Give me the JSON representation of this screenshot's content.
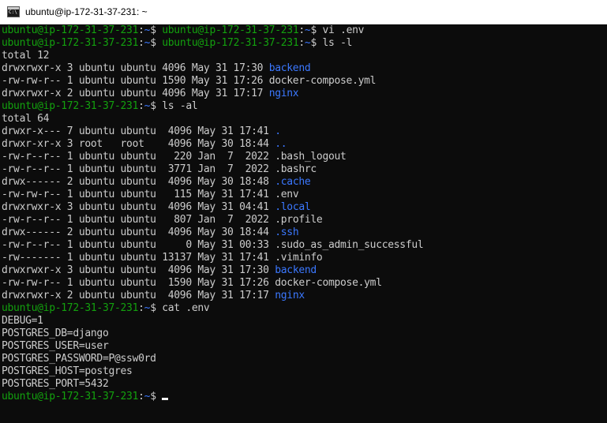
{
  "window": {
    "title": "ubuntu@ip-172-31-37-231: ~",
    "icon": "console-app-icon"
  },
  "colors": {
    "background": "#0c0c0c",
    "foreground": "#cccccc",
    "user_host": "#13a10e",
    "path": "#3b78ff",
    "directory": "#3b78ff"
  },
  "terminal": {
    "lines": [
      {
        "type": "prompt",
        "user_host": "ubuntu@ip-172-31-37-231",
        "sep": ":",
        "path": "~",
        "sym": "$ ",
        "cmd": "ubuntu@ip-172-31-37-231:~$ vi .env"
      },
      {
        "type": "prompt",
        "user_host": "ubuntu@ip-172-31-37-231",
        "sep": ":",
        "path": "~",
        "sym": "$ ",
        "cmd": "ubuntu@ip-172-31-37-231:~$ ls -l"
      },
      {
        "type": "text",
        "text": "total 12"
      },
      {
        "type": "entry",
        "meta": "drwxrwxr-x 3 ubuntu ubuntu 4096 May 31 17:30 ",
        "name": "backend",
        "dir": true
      },
      {
        "type": "entry",
        "meta": "-rw-rw-r-- 1 ubuntu ubuntu 1590 May 31 17:26 ",
        "name": "docker-compose.yml",
        "dir": false
      },
      {
        "type": "entry",
        "meta": "drwxrwxr-x 2 ubuntu ubuntu 4096 May 31 17:17 ",
        "name": "nginx",
        "dir": true
      },
      {
        "type": "prompt",
        "user_host": "ubuntu@ip-172-31-37-231",
        "sep": ":",
        "path": "~",
        "sym": "$ ",
        "cmd": "ls -al"
      },
      {
        "type": "text",
        "text": "total 64"
      },
      {
        "type": "entry",
        "meta": "drwxr-x--- 7 ubuntu ubuntu  4096 May 31 17:41 ",
        "name": ".",
        "dir": true
      },
      {
        "type": "entry",
        "meta": "drwxr-xr-x 3 root   root    4096 May 30 18:44 ",
        "name": "..",
        "dir": true
      },
      {
        "type": "entry",
        "meta": "-rw-r--r-- 1 ubuntu ubuntu   220 Jan  7  2022 ",
        "name": ".bash_logout",
        "dir": false
      },
      {
        "type": "entry",
        "meta": "-rw-r--r-- 1 ubuntu ubuntu  3771 Jan  7  2022 ",
        "name": ".bashrc",
        "dir": false
      },
      {
        "type": "entry",
        "meta": "drwx------ 2 ubuntu ubuntu  4096 May 30 18:48 ",
        "name": ".cache",
        "dir": true
      },
      {
        "type": "entry",
        "meta": "-rw-rw-r-- 1 ubuntu ubuntu   115 May 31 17:41 ",
        "name": ".env",
        "dir": false
      },
      {
        "type": "entry",
        "meta": "drwxrwxr-x 3 ubuntu ubuntu  4096 May 31 04:41 ",
        "name": ".local",
        "dir": true
      },
      {
        "type": "entry",
        "meta": "-rw-r--r-- 1 ubuntu ubuntu   807 Jan  7  2022 ",
        "name": ".profile",
        "dir": false
      },
      {
        "type": "entry",
        "meta": "drwx------ 2 ubuntu ubuntu  4096 May 30 18:44 ",
        "name": ".ssh",
        "dir": true
      },
      {
        "type": "entry",
        "meta": "-rw-r--r-- 1 ubuntu ubuntu     0 May 31 00:33 ",
        "name": ".sudo_as_admin_successful",
        "dir": false
      },
      {
        "type": "entry",
        "meta": "-rw------- 1 ubuntu ubuntu 13137 May 31 17:41 ",
        "name": ".viminfo",
        "dir": false
      },
      {
        "type": "entry",
        "meta": "drwxrwxr-x 3 ubuntu ubuntu  4096 May 31 17:30 ",
        "name": "backend",
        "dir": true
      },
      {
        "type": "entry",
        "meta": "-rw-rw-r-- 1 ubuntu ubuntu  1590 May 31 17:26 ",
        "name": "docker-compose.yml",
        "dir": false
      },
      {
        "type": "entry",
        "meta": "drwxrwxr-x 2 ubuntu ubuntu  4096 May 31 17:17 ",
        "name": "nginx",
        "dir": true
      },
      {
        "type": "prompt",
        "user_host": "ubuntu@ip-172-31-37-231",
        "sep": ":",
        "path": "~",
        "sym": "$ ",
        "cmd": "cat .env"
      },
      {
        "type": "text",
        "text": "DEBUG=1"
      },
      {
        "type": "text",
        "text": "POSTGRES_DB=django"
      },
      {
        "type": "text",
        "text": "POSTGRES_USER=user"
      },
      {
        "type": "text",
        "text": "POSTGRES_PASSWORD=P@ssw0rd"
      },
      {
        "type": "text",
        "text": "POSTGRES_HOST=postgres"
      },
      {
        "type": "text",
        "text": "POSTGRES_PORT=5432"
      },
      {
        "type": "prompt",
        "user_host": "ubuntu@ip-172-31-37-231",
        "sep": ":",
        "path": "~",
        "sym": "$ ",
        "cmd": "",
        "cursor": true
      }
    ]
  }
}
